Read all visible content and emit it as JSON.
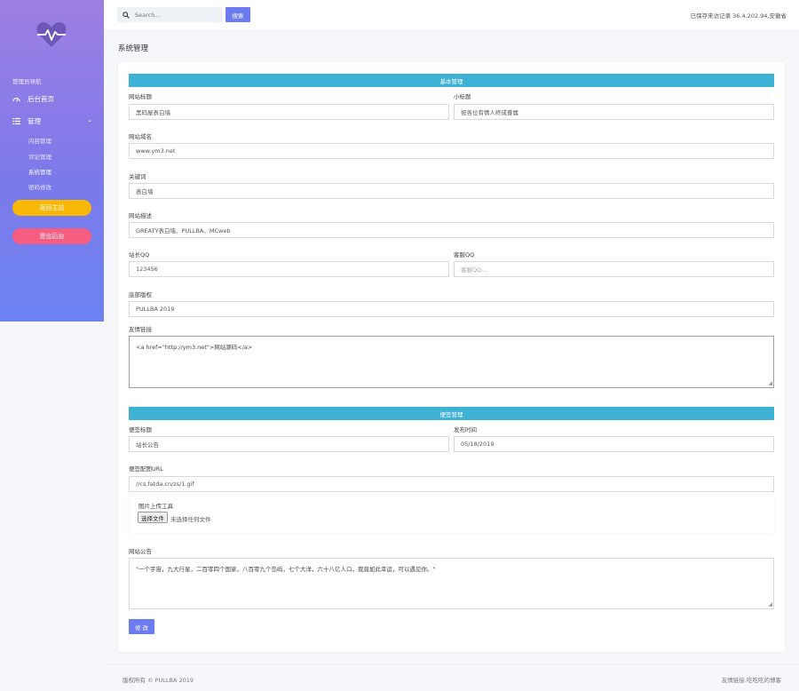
{
  "sidebar": {
    "nav_title": "管理员导航",
    "home_label": "后台首页",
    "manage_label": "管理",
    "sub_items": [
      "内容管理",
      "评论管理",
      "系统管理",
      "密码修改"
    ],
    "return_label": "返回主站",
    "logout_label": "登出后台",
    "colors": {
      "return": "#f8b805",
      "logout": "#f65d80"
    }
  },
  "topbar": {
    "search_placeholder": "Search...",
    "search_button": "搜索",
    "visit_info": "已保存来访记录 36.4.202.94,安徽省"
  },
  "page_title": "系统管理",
  "basic": {
    "section_title": "基本管理",
    "site_title_label": "网站标题",
    "site_title_value": "黑码屋表白墙",
    "subtitle_label": "小标题",
    "subtitle_value": "祝各位有情人终成眷属",
    "domain_label": "网站域名",
    "domain_value": "www.ym3.net",
    "keywords_label": "关键词",
    "keywords_value": "表白墙",
    "desc_label": "网站描述",
    "desc_value": "GREATY表白墙、PULLBA、MCweb",
    "owner_qq_label": "站长QQ",
    "owner_qq_value": "123456",
    "service_qq_label": "客服QQ",
    "service_qq_placeholder": "客服QQ...",
    "copyright_label": "底部版权",
    "copyright_value": "PULLBA 2019",
    "links_label": "友情链接",
    "links_value": "<a href=\"http://ym3.net\">网站源码</a>"
  },
  "notice": {
    "section_title": "便签管理",
    "notice_title_label": "便签标题",
    "notice_title_value": "站长公告",
    "publish_time_label": "发布时间",
    "publish_time_value": "05/18/2019",
    "image_url_label": "便签配图URL",
    "image_url_value": "//cs.fatda.cn/zs/1.gif",
    "upload_title": "图片上传工具",
    "file_button": "选择文件",
    "file_status": "未选择任何文件",
    "announcement_label": "网站公告",
    "announcement_value": "\"一个宇宙，九大行星，二百零四个国家，八百零九个岛屿，七个大洋，六十八亿人口，我竟如此幸运，可以遇见你。\"",
    "submit_label": "修 改"
  },
  "footer": {
    "copyright": "版权所有 © PULLBA 2019",
    "links": "友情链接:吃吃吃的博客"
  },
  "colors": {
    "accent": "#6c7cf0",
    "section_bar": "#3db2d5"
  }
}
